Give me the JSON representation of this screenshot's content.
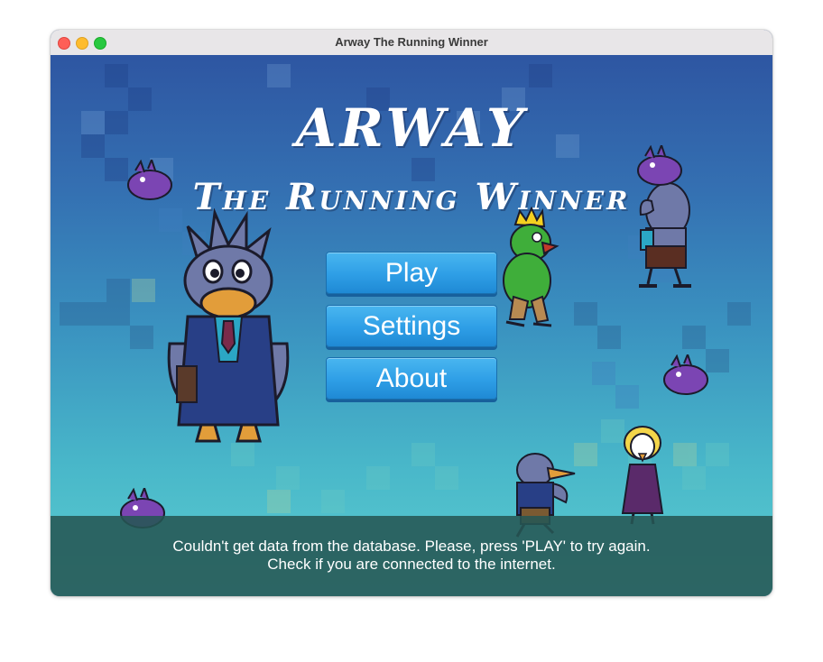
{
  "window": {
    "title": "Arway The Running Winner"
  },
  "game": {
    "title_line_1": "ARWAY",
    "title_line_2": "The Running Winner"
  },
  "menu": {
    "play_label": "Play",
    "settings_label": "Settings",
    "about_label": "About"
  },
  "status": {
    "line_1": "Couldn't get data from the database. Please, press 'PLAY' to try again.",
    "line_2": "Check if you are connected to the internet."
  },
  "icons": {
    "close": "close-icon",
    "minimize": "minimize-icon",
    "maximize": "maximize-icon"
  },
  "colors": {
    "button": "#2e9ee6",
    "status_bar": "#265654",
    "sky_top": "#2e56a2",
    "sky_bottom": "#5ccfd0"
  }
}
